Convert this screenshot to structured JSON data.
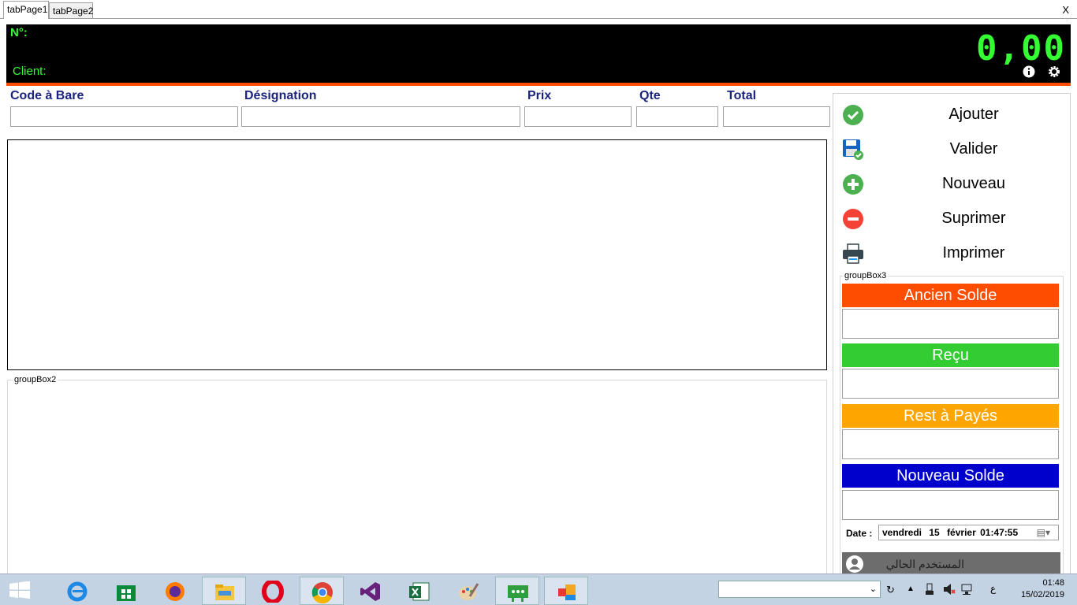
{
  "tabs": [
    "tabPage1",
    "tabPage2"
  ],
  "close_label": "X",
  "header": {
    "number_label": "N°:",
    "client_label": "Client:",
    "total_display": "0,00"
  },
  "fields": {
    "barcode": "Code à Bare",
    "designation": "Désignation",
    "price": "Prix",
    "qty": "Qte",
    "total": "Total"
  },
  "groupbox2": "groupBox2",
  "groupbox3": "groupBox3",
  "actions": {
    "add": "Ajouter",
    "validate": "Valider",
    "new": "Nouveau",
    "delete": "Suprimer",
    "print": "Imprimer"
  },
  "solde": {
    "old": "Ancien Solde",
    "received": "Reçu",
    "remaining": "Rest à Payés",
    "new": "Nouveau Solde",
    "colors": {
      "old": "#ff4d00",
      "received": "#33cc33",
      "remaining": "#ffa500",
      "new": "#0000cc"
    }
  },
  "date": {
    "label": "Date :",
    "weekday": "vendredi",
    "day": "15",
    "month": "février",
    "time": "01:47:55"
  },
  "current_user": "المستخدم الحالي",
  "taskbar": {
    "lang": "ع",
    "time": "01:48",
    "date": "15/02/2019"
  }
}
